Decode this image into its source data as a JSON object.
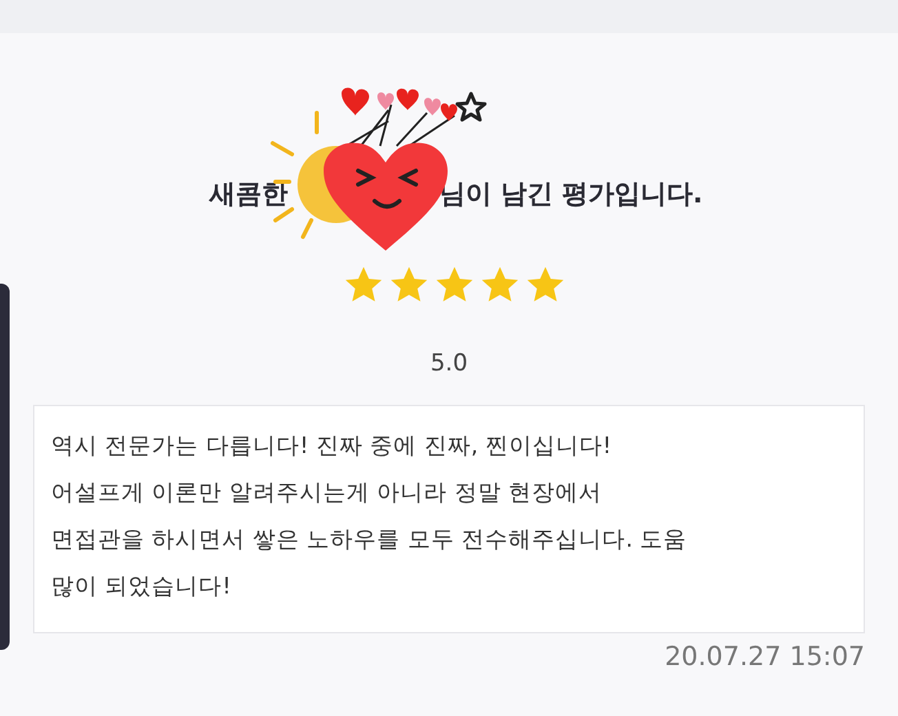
{
  "review": {
    "title_start": "새콤한",
    "title_end": "님이 남긴 평가입니다.",
    "stars": 5,
    "score": "5.0",
    "body": "역시 전문가는 다릅니다! 진짜 중에 진짜, 찐이십니다!\n어설프게 이론만 알려주시는게 아니라 정말 현장에서\n면접관을 하시면서 쌓은 노하우를 모두 전수해주십니다. 도움\n많이 되었습니다!",
    "date": "20.07.27 15:07"
  }
}
